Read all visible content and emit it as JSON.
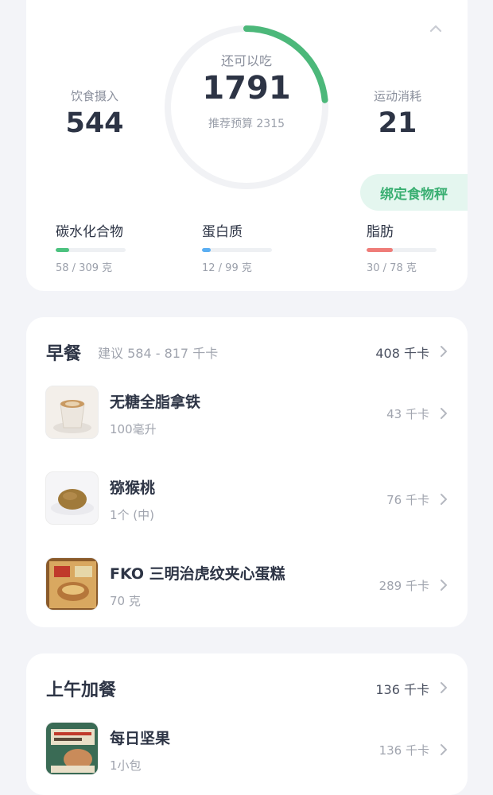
{
  "summary": {
    "intake_label": "饮食摄入",
    "intake_value": "544",
    "remaining_label": "还可以吃",
    "remaining_value": "1791",
    "budget_text": "推荐预算 2315",
    "exercise_label": "运动消耗",
    "exercise_value": "21",
    "ring_progress": 0.235,
    "bind_scale_label": "绑定食物秤",
    "colors": {
      "ring": "#4cb87a",
      "ring_track": "#f1f2f5"
    }
  },
  "macros": [
    {
      "name": "碳水化合物",
      "amount": "58 / 309 克",
      "progress": 0.19,
      "color": "#4cc27f"
    },
    {
      "name": "蛋白质",
      "amount": "12 / 99 克",
      "progress": 0.12,
      "color": "#5aaef2"
    },
    {
      "name": "脂肪",
      "amount": "30 / 78 克",
      "progress": 0.38,
      "color": "#ef7c78"
    }
  ],
  "breakfast": {
    "title": "早餐",
    "hint": "建议 584 - 817 千卡",
    "total": "408 千卡",
    "items": [
      {
        "name": "无糖全脂拿铁",
        "qty": "100毫升",
        "kcal": "43 千卡",
        "icon": "latte-image"
      },
      {
        "name": "猕猴桃",
        "qty": "1个 (中)",
        "kcal": "76 千卡",
        "icon": "kiwi-image"
      },
      {
        "name": "FKO 三明治虎纹夹心蛋糕",
        "qty": "70 克",
        "kcal": "289 千卡",
        "icon": "cake-package-image"
      }
    ]
  },
  "morning_snack": {
    "title": "上午加餐",
    "total": "136 千卡",
    "items": [
      {
        "name": "每日坚果",
        "qty": "1小包",
        "kcal": "136 千卡",
        "icon": "nuts-package-image"
      }
    ]
  }
}
